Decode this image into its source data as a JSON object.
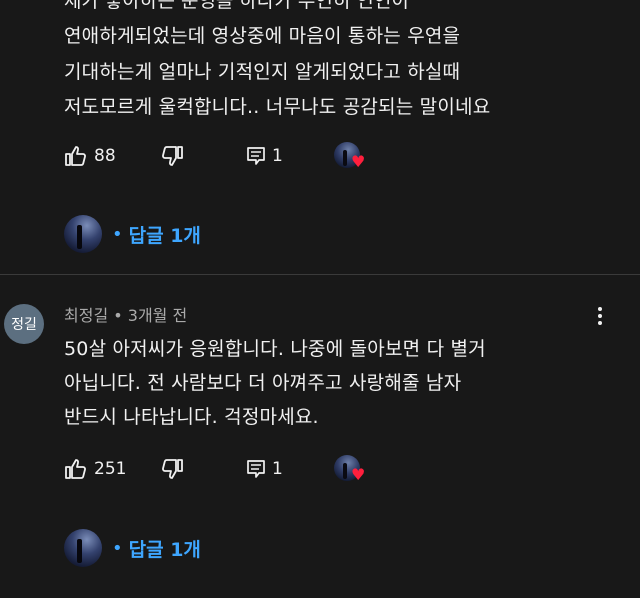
{
  "comment1": {
    "lines": [
      "제가 좋아하는 운영을 하다가 우연히 인연이",
      "연애하게되었는데 영상중에 마음이 통하는 우연을",
      "기대하는게 얼마나 기적인지 알게되었다고 하실때",
      "저도모르게 울컥합니다.. 너무나도 공감되는 말이네요"
    ],
    "likes": "88",
    "replies_count": "1",
    "reply_link": "답글 1개"
  },
  "comment2": {
    "author_initials": "정길",
    "meta": "최정길 • 3개월 전",
    "lines": [
      "50살 아저씨가 응원합니다. 나중에 돌아보면 다 별거",
      "아닙니다. 전 사람보다 더 아껴주고 사랑해줄 남자",
      "반드시 나타납니다. 걱정마세요."
    ],
    "likes": "251",
    "replies_count": "1",
    "reply_link": "답글 1개"
  },
  "icons": {
    "like": "thumbs-up-icon",
    "dislike": "thumbs-down-icon",
    "reply": "reply-comment-icon",
    "more": "more-vert-icon",
    "creator_heart": "creator-heart-icon"
  },
  "colors": {
    "background": "#181818",
    "text": "#f1f1f1",
    "secondary_text": "#aaaaaa",
    "link": "#3ea6ff",
    "heart": "#ff1f3d",
    "author_avatar": "#5c6f80"
  }
}
